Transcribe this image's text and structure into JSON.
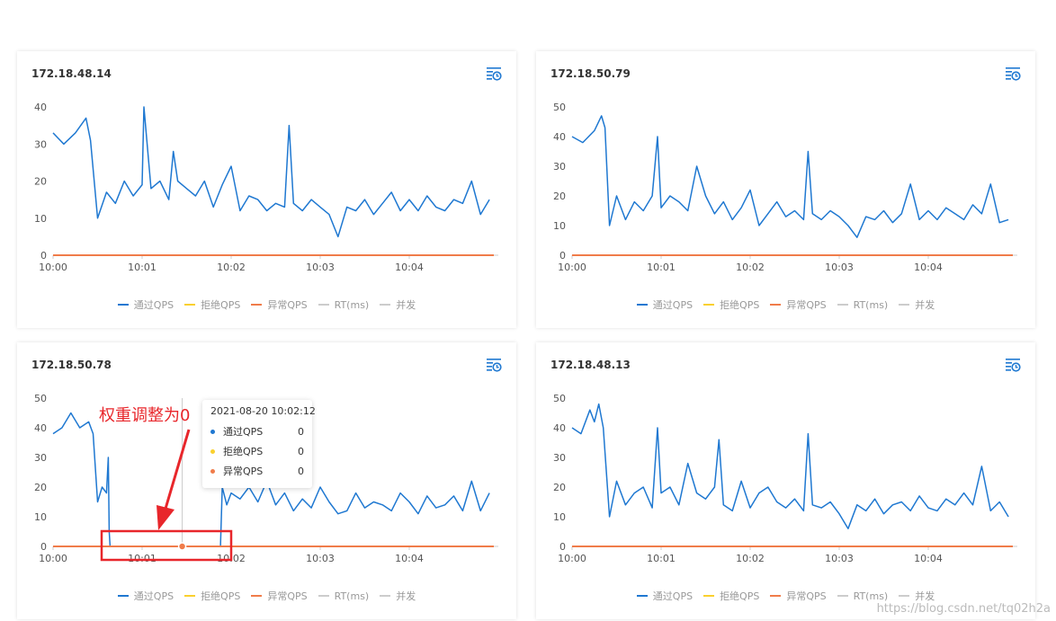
{
  "colors": {
    "pass": "#1f78d1",
    "block": "#fad02e",
    "exception": "#f07c4a",
    "rt": "#c8c8c8",
    "concurrency": "#c8c8c8",
    "annotation": "#e8262b"
  },
  "legend": [
    {
      "label": "通过QPS",
      "color": "#1f78d1"
    },
    {
      "label": "拒绝QPS",
      "color": "#fad02e"
    },
    {
      "label": "异常QPS",
      "color": "#f07c4a"
    },
    {
      "label": "RT(ms)",
      "color": "#cccccc"
    },
    {
      "label": "并发",
      "color": "#cccccc"
    }
  ],
  "cards": [
    {
      "title": "172.18.48.14",
      "icon": "history-clock-icon"
    },
    {
      "title": "172.18.50.79",
      "icon": "history-clock-icon"
    },
    {
      "title": "172.18.50.78",
      "icon": "history-clock-icon"
    },
    {
      "title": "172.18.48.13",
      "icon": "history-clock-icon"
    }
  ],
  "tooltip": {
    "time": "2021-08-20 10:02:12",
    "rows": [
      {
        "label": "通过QPS",
        "value": "0",
        "color": "#1f78d1"
      },
      {
        "label": "拒绝QPS",
        "value": "0",
        "color": "#fad02e"
      },
      {
        "label": "异常QPS",
        "value": "0",
        "color": "#f07c4a"
      }
    ]
  },
  "annotation": {
    "text": "权重调整为0"
  },
  "watermark": "https://blog.csdn.net/tq02h2a",
  "chart_data": [
    {
      "type": "line",
      "title": "172.18.48.14",
      "x_ticks": [
        "10:00",
        "10:01",
        "10:02",
        "10:03",
        "10:04"
      ],
      "ylim": [
        0,
        40
      ],
      "y_ticks": [
        0,
        10,
        20,
        30,
        40
      ],
      "x_range_min": [
        0,
        5
      ],
      "series": [
        {
          "name": "通过QPS",
          "color": "#1f78d1",
          "x": [
            0,
            0.12,
            0.25,
            0.37,
            0.42,
            0.5,
            0.6,
            0.7,
            0.8,
            0.9,
            1.0,
            1.02,
            1.1,
            1.2,
            1.3,
            1.35,
            1.4,
            1.5,
            1.6,
            1.7,
            1.8,
            1.9,
            2.0,
            2.1,
            2.2,
            2.3,
            2.4,
            2.5,
            2.6,
            2.65,
            2.7,
            2.8,
            2.9,
            3.0,
            3.1,
            3.2,
            3.3,
            3.4,
            3.5,
            3.6,
            3.7,
            3.8,
            3.9,
            4.0,
            4.1,
            4.2,
            4.3,
            4.4,
            4.5,
            4.6,
            4.7,
            4.8,
            4.9
          ],
          "values": [
            33,
            30,
            33,
            37,
            31,
            10,
            17,
            14,
            20,
            16,
            19,
            40,
            18,
            20,
            15,
            28,
            20,
            18,
            16,
            20,
            13,
            19,
            24,
            12,
            16,
            15,
            12,
            14,
            13,
            35,
            14,
            12,
            15,
            13,
            11,
            5,
            13,
            12,
            15,
            11,
            14,
            17,
            12,
            15,
            12,
            16,
            13,
            12,
            15,
            14,
            20,
            11,
            15
          ]
        },
        {
          "name": "异常QPS",
          "color": "#f07c4a",
          "x": [
            0,
            4.95
          ],
          "values": [
            0,
            0
          ]
        }
      ]
    },
    {
      "type": "line",
      "title": "172.18.50.79",
      "x_ticks": [
        "10:00",
        "10:01",
        "10:02",
        "10:03",
        "10:04"
      ],
      "ylim": [
        0,
        50
      ],
      "y_ticks": [
        0,
        10,
        20,
        30,
        40,
        50
      ],
      "x_range_min": [
        0,
        5
      ],
      "series": [
        {
          "name": "通过QPS",
          "color": "#1f78d1",
          "x": [
            0,
            0.12,
            0.25,
            0.33,
            0.37,
            0.42,
            0.5,
            0.6,
            0.7,
            0.8,
            0.9,
            0.96,
            1.0,
            1.1,
            1.2,
            1.3,
            1.4,
            1.5,
            1.6,
            1.7,
            1.8,
            1.9,
            2.0,
            2.1,
            2.2,
            2.3,
            2.4,
            2.5,
            2.6,
            2.65,
            2.7,
            2.8,
            2.9,
            3.0,
            3.1,
            3.2,
            3.3,
            3.4,
            3.5,
            3.6,
            3.7,
            3.8,
            3.9,
            4.0,
            4.1,
            4.2,
            4.3,
            4.4,
            4.5,
            4.6,
            4.7,
            4.8,
            4.9
          ],
          "values": [
            40,
            38,
            42,
            47,
            43,
            10,
            20,
            12,
            18,
            15,
            20,
            40,
            16,
            20,
            18,
            15,
            30,
            20,
            14,
            18,
            12,
            16,
            22,
            10,
            14,
            18,
            13,
            15,
            12,
            35,
            14,
            12,
            15,
            13,
            10,
            6,
            13,
            12,
            15,
            11,
            14,
            24,
            12,
            15,
            12,
            16,
            14,
            12,
            17,
            14,
            24,
            11,
            12
          ]
        },
        {
          "name": "异常QPS",
          "color": "#f07c4a",
          "x": [
            0,
            4.95
          ],
          "values": [
            0,
            0
          ]
        }
      ]
    },
    {
      "type": "line",
      "title": "172.18.50.78",
      "x_ticks": [
        "10:00",
        "10:01",
        "10:02",
        "10:03",
        "10:04"
      ],
      "ylim": [
        0,
        50
      ],
      "y_ticks": [
        0,
        10,
        20,
        30,
        40,
        50
      ],
      "x_range_min": [
        0,
        5
      ],
      "series": [
        {
          "name": "通过QPS",
          "color": "#1f78d1",
          "x": [
            0,
            0.1,
            0.2,
            0.3,
            0.4,
            0.45,
            0.5,
            0.55,
            0.6,
            0.62,
            0.63,
            0.64,
            1.88,
            1.9,
            1.95,
            2.0,
            2.1,
            2.2,
            2.3,
            2.4,
            2.5,
            2.6,
            2.7,
            2.8,
            2.9,
            3.0,
            3.1,
            3.2,
            3.3,
            3.4,
            3.5,
            3.6,
            3.7,
            3.8,
            3.9,
            4.0,
            4.1,
            4.2,
            4.3,
            4.4,
            4.5,
            4.6,
            4.7,
            4.8,
            4.9
          ],
          "values": [
            38,
            40,
            45,
            40,
            42,
            38,
            15,
            20,
            18,
            30,
            5,
            0,
            0,
            20,
            14,
            18,
            16,
            20,
            15,
            22,
            14,
            18,
            12,
            16,
            13,
            20,
            15,
            11,
            12,
            18,
            13,
            15,
            14,
            12,
            18,
            15,
            11,
            17,
            13,
            14,
            17,
            12,
            22,
            12,
            18
          ]
        },
        {
          "name": "异常QPS",
          "color": "#f07c4a",
          "x": [
            0,
            4.95
          ],
          "values": [
            0,
            0
          ]
        }
      ]
    },
    {
      "type": "line",
      "title": "172.18.48.13",
      "x_ticks": [
        "10:00",
        "10:01",
        "10:02",
        "10:03",
        "10:04"
      ],
      "ylim": [
        0,
        50
      ],
      "y_ticks": [
        0,
        10,
        20,
        30,
        40,
        50
      ],
      "x_range_min": [
        0,
        5
      ],
      "series": [
        {
          "name": "通过QPS",
          "color": "#1f78d1",
          "x": [
            0,
            0.1,
            0.2,
            0.25,
            0.3,
            0.35,
            0.42,
            0.5,
            0.6,
            0.7,
            0.8,
            0.9,
            0.96,
            1.0,
            1.1,
            1.2,
            1.3,
            1.4,
            1.5,
            1.6,
            1.65,
            1.7,
            1.8,
            1.9,
            2.0,
            2.1,
            2.2,
            2.3,
            2.4,
            2.5,
            2.6,
            2.65,
            2.7,
            2.8,
            2.9,
            3.0,
            3.1,
            3.2,
            3.3,
            3.4,
            3.5,
            3.6,
            3.7,
            3.8,
            3.9,
            4.0,
            4.1,
            4.2,
            4.3,
            4.4,
            4.5,
            4.6,
            4.7,
            4.8,
            4.9
          ],
          "values": [
            40,
            38,
            46,
            42,
            48,
            40,
            10,
            22,
            14,
            18,
            20,
            13,
            40,
            18,
            20,
            14,
            28,
            18,
            16,
            20,
            36,
            14,
            12,
            22,
            13,
            18,
            20,
            15,
            13,
            16,
            12,
            38,
            14,
            13,
            15,
            11,
            6,
            14,
            12,
            16,
            11,
            14,
            15,
            12,
            17,
            13,
            12,
            16,
            14,
            18,
            14,
            27,
            12,
            15,
            10
          ]
        },
        {
          "name": "异常QPS",
          "color": "#f07c4a",
          "x": [
            0,
            4.95
          ],
          "values": [
            0,
            0
          ]
        }
      ]
    }
  ]
}
